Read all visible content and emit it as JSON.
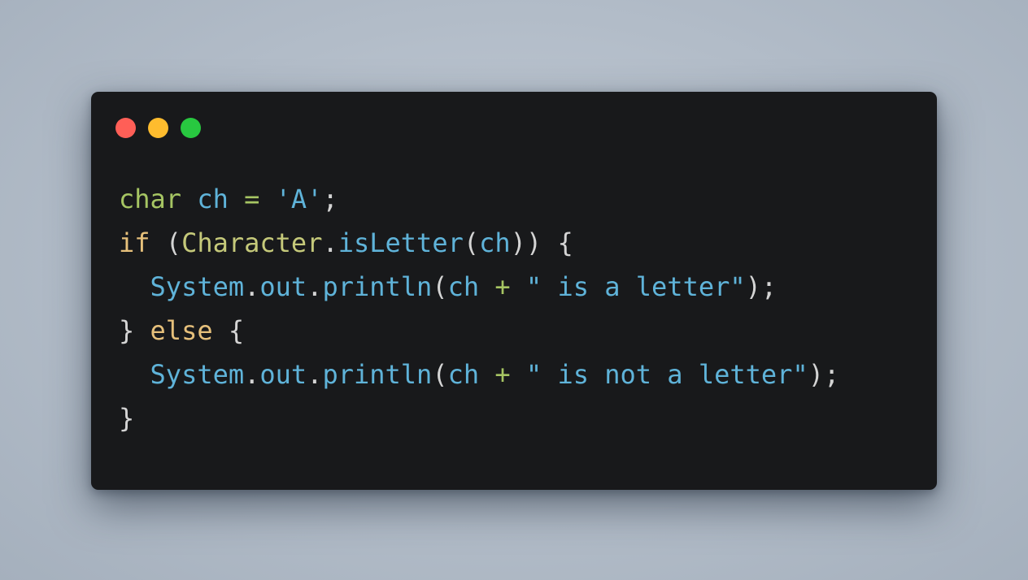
{
  "window": {
    "buttons": {
      "close_color": "#ff5f57",
      "minimize_color": "#febc2e",
      "maximize_color": "#28c840"
    }
  },
  "code": {
    "language": "java",
    "lines": [
      [
        {
          "t": "char",
          "c": "kw-type"
        },
        {
          "t": " ",
          "c": "punc"
        },
        {
          "t": "ch",
          "c": "ident"
        },
        {
          "t": " = ",
          "c": "op"
        },
        {
          "t": "'A'",
          "c": "ident"
        },
        {
          "t": ";",
          "c": "punc"
        }
      ],
      [
        {
          "t": "if",
          "c": "kw-ctrl"
        },
        {
          "t": " (",
          "c": "punc"
        },
        {
          "t": "Character",
          "c": "cls"
        },
        {
          "t": ".",
          "c": "punc"
        },
        {
          "t": "isLetter",
          "c": "ident"
        },
        {
          "t": "(",
          "c": "punc"
        },
        {
          "t": "ch",
          "c": "ident"
        },
        {
          "t": ")) {",
          "c": "punc"
        }
      ],
      [
        {
          "t": "  ",
          "c": "punc"
        },
        {
          "t": "System",
          "c": "ident"
        },
        {
          "t": ".",
          "c": "punc"
        },
        {
          "t": "out",
          "c": "ident"
        },
        {
          "t": ".",
          "c": "punc"
        },
        {
          "t": "println",
          "c": "ident"
        },
        {
          "t": "(",
          "c": "punc"
        },
        {
          "t": "ch",
          "c": "ident"
        },
        {
          "t": " + ",
          "c": "op"
        },
        {
          "t": "\" is a letter\"",
          "c": "ident"
        },
        {
          "t": ");",
          "c": "punc"
        }
      ],
      [
        {
          "t": "} ",
          "c": "punc"
        },
        {
          "t": "else",
          "c": "kw-ctrl"
        },
        {
          "t": " {",
          "c": "punc"
        }
      ],
      [
        {
          "t": "  ",
          "c": "punc"
        },
        {
          "t": "System",
          "c": "ident"
        },
        {
          "t": ".",
          "c": "punc"
        },
        {
          "t": "out",
          "c": "ident"
        },
        {
          "t": ".",
          "c": "punc"
        },
        {
          "t": "println",
          "c": "ident"
        },
        {
          "t": "(",
          "c": "punc"
        },
        {
          "t": "ch",
          "c": "ident"
        },
        {
          "t": " + ",
          "c": "op"
        },
        {
          "t": "\" is not a letter\"",
          "c": "ident"
        },
        {
          "t": ");",
          "c": "punc"
        }
      ],
      [
        {
          "t": "}",
          "c": "punc"
        }
      ]
    ]
  }
}
